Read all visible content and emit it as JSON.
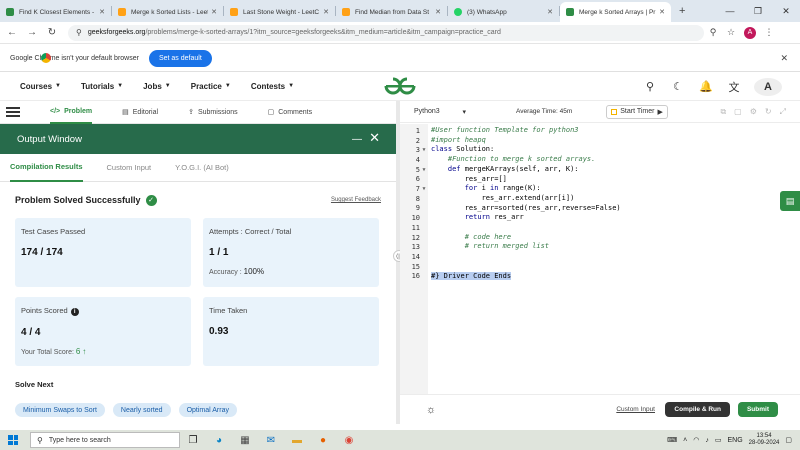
{
  "browser": {
    "tabs": [
      {
        "label": "Find K Closest Elements - L",
        "icon": "gfg-favicon",
        "active": false
      },
      {
        "label": "Merge k Sorted Lists - Leet",
        "icon": "leetcode-favicon",
        "active": false
      },
      {
        "label": "Last Stone Weight - LeetC",
        "icon": "leetcode-favicon",
        "active": false
      },
      {
        "label": "Find Median from Data St",
        "icon": "leetcode-favicon",
        "active": false
      },
      {
        "label": "(3) WhatsApp",
        "icon": "whatsapp-favicon",
        "active": false
      },
      {
        "label": "Merge k Sorted Arrays | Pr",
        "icon": "gfg-favicon",
        "active": true
      }
    ],
    "url_host": "geeksforgeeks.org",
    "url_rest": "/problems/merge-k-sorted-arrays/1?itm_source=geeksforgeeks&itm_medium=article&itm_campaign=practice_card",
    "profile_initial": "A",
    "infobar_message": "Google Chrome isn't your default browser",
    "infobar_button": "Set as default"
  },
  "site": {
    "menus": [
      "Courses",
      "Tutorials",
      "Jobs",
      "Practice",
      "Contests"
    ],
    "avatar_initial": "A"
  },
  "subnav": {
    "tabs": [
      "Problem",
      "Editorial",
      "Submissions",
      "Comments"
    ]
  },
  "output": {
    "title": "Output Window",
    "tabs": [
      "Compilation Results",
      "Custom Input",
      "Y.O.G.I. (AI Bot)"
    ],
    "status": "Problem Solved Successfully",
    "feedback": "Suggest Feedback",
    "cards": {
      "tests_label": "Test Cases Passed",
      "tests_value": "174 / 174",
      "attempts_label": "Attempts : Correct / Total",
      "attempts_value": "1 / 1",
      "accuracy_label": "Accuracy :",
      "accuracy_value": "100%",
      "points_label": "Points Scored",
      "points_value": "4 / 4",
      "total_label": "Your Total Score:",
      "total_value": "6",
      "time_label": "Time Taken",
      "time_value": "0.93"
    },
    "solve_next": "Solve Next",
    "next": [
      "Minimum Swaps to Sort",
      "Nearly sorted",
      "Optimal Array"
    ]
  },
  "editor": {
    "language": "Python3",
    "average_time": "Average Time: 45m",
    "timer": "Start Timer",
    "lines": [
      "#User function Template for python3",
      "#import heapq",
      "class Solution:",
      "    #Function to merge k sorted arrays.",
      "    def mergeKArrays(self, arr, K):",
      "        res_arr=[]",
      "        for i in range(K):",
      "            res_arr.extend(arr[i])",
      "        res_arr=sorted(res_arr,reverse=False)",
      "        return res_arr",
      "",
      "        # code here",
      "        # return merged list",
      "",
      "",
      "#} Driver Code Ends"
    ],
    "custom_input": "Custom Input",
    "compile_run": "Compile & Run",
    "submit": "Submit"
  },
  "taskbar": {
    "search": "Type here to search",
    "lang": "ENG",
    "time": "13:54",
    "date": "28-09-2024"
  }
}
